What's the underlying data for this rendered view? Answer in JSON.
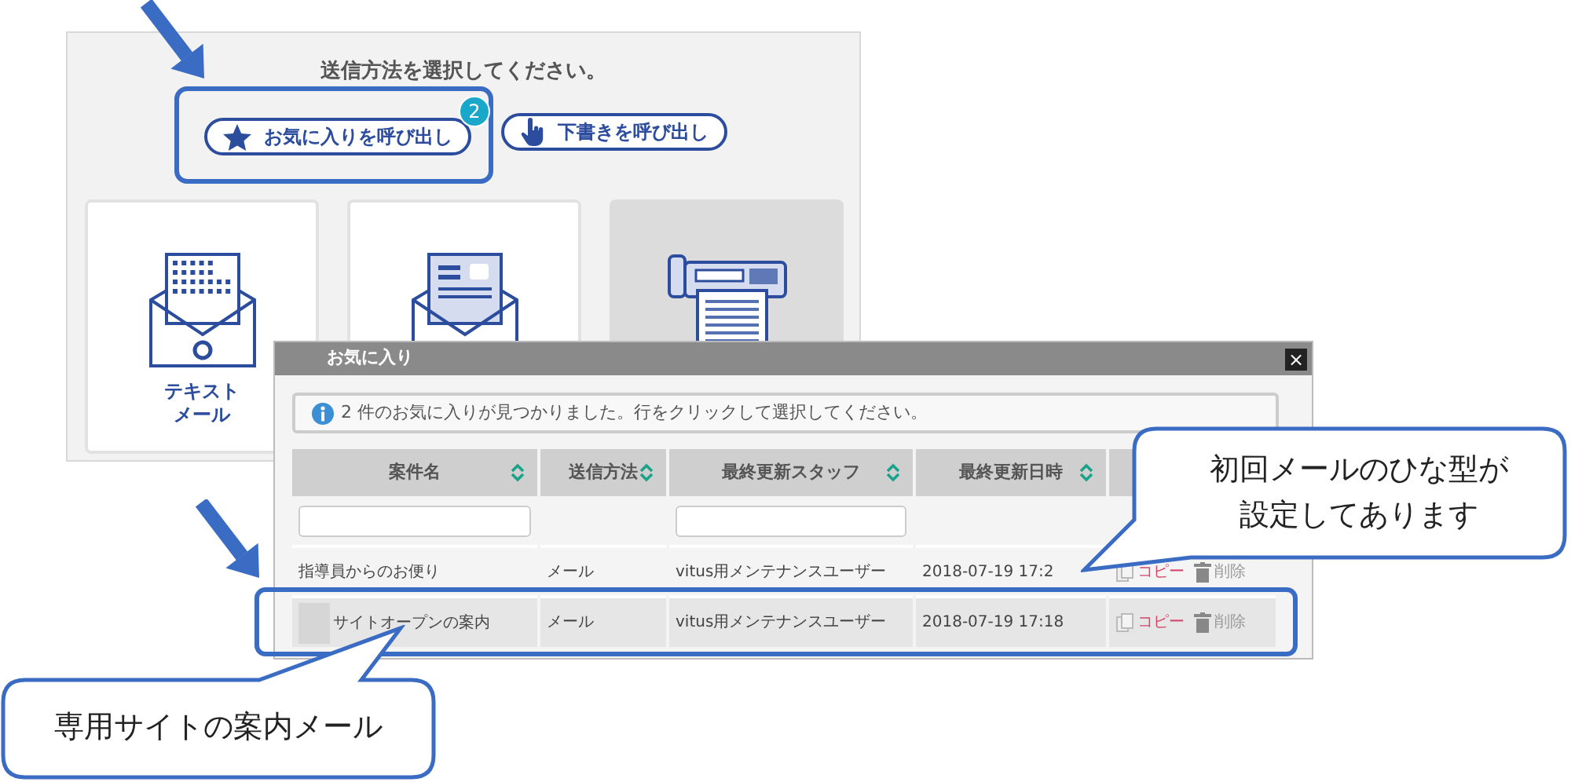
{
  "panel": {
    "title": "送信方法を選択してください。",
    "buttons": [
      {
        "kind": "favorites",
        "label": "お気に入りを呼び出し",
        "badge": "2",
        "highlighted": true
      },
      {
        "kind": "drafts",
        "label": "下書きを呼び出し",
        "highlighted": false
      }
    ],
    "cards": [
      {
        "kind": "text_mail",
        "label_lines": [
          "テキスト",
          "メール"
        ],
        "disabled": false
      },
      {
        "kind": "html_mail",
        "disabled": false
      },
      {
        "kind": "fax",
        "disabled": true
      }
    ]
  },
  "dialog": {
    "title": "お気に入り",
    "close": "×",
    "info": "2 件のお気に入りが見つかりました。行をクリックして選択してください。",
    "columns": [
      {
        "label": "案件名",
        "sortable": true,
        "filter": true
      },
      {
        "label": "送信方法",
        "sortable": true,
        "filter": false
      },
      {
        "label": "最終更新スタッフ",
        "sortable": true,
        "filter": true
      },
      {
        "label": "最終更新日時",
        "sortable": true,
        "filter": false
      }
    ],
    "rows": [
      {
        "cells": [
          "指導員からのお便り",
          "メール",
          "vitus用メンテナンスユーザー",
          "2018-07-19 17:2"
        ],
        "copy": "コピー",
        "delete": "削除",
        "selected": false,
        "redacted": false,
        "highlighted": false
      },
      {
        "cells": [
          "サイトオープンの案内",
          "メール",
          "vitus用メンテナンスユーザー",
          "2018-07-19 17:18"
        ],
        "copy": "コピー",
        "delete": "削除",
        "selected": true,
        "redacted": true,
        "highlighted": true
      }
    ]
  },
  "callouts": [
    {
      "kind": "upper_right",
      "lines": [
        "初回メールのひな型が",
        "設定してあります"
      ]
    },
    {
      "kind": "lower_left",
      "lines": [
        "専用サイトの案内メール"
      ]
    }
  ]
}
